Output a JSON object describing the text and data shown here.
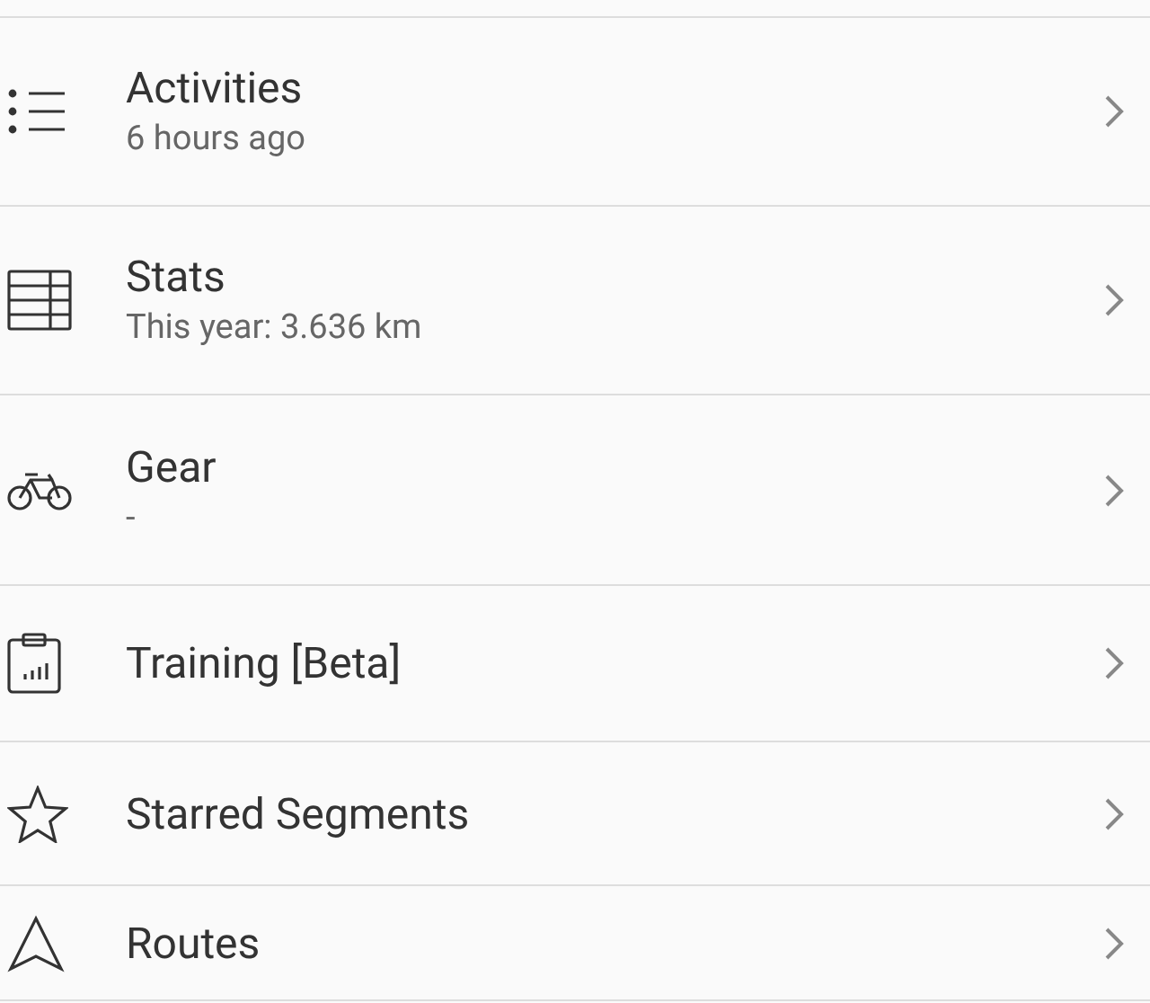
{
  "menu": [
    {
      "kind": "list",
      "title": "Activities",
      "subtitle": "6 hours ago"
    },
    {
      "kind": "table",
      "title": "Stats",
      "subtitle": "This year: 3.636 km"
    },
    {
      "kind": "bike",
      "title": "Gear",
      "subtitle": "-"
    },
    {
      "kind": "clipboard",
      "title": "Training [Beta]"
    },
    {
      "kind": "star",
      "title": "Starred Segments"
    },
    {
      "kind": "nav",
      "title": "Routes"
    }
  ]
}
